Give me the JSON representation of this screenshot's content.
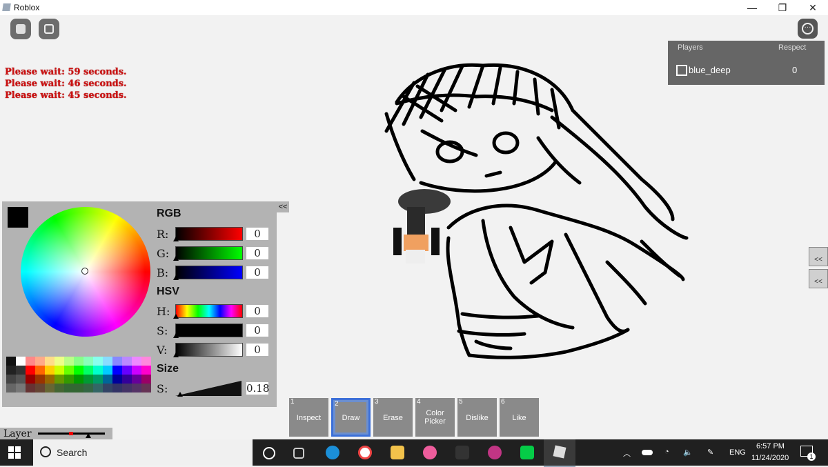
{
  "window": {
    "title": "Roblox",
    "minimize": "—",
    "restore": "❐",
    "close": "✕"
  },
  "waits": [
    "Please wait: 59 seconds.",
    "Please wait: 46 seconds.",
    "Please wait: 45 seconds."
  ],
  "players": {
    "header_players": "Players",
    "header_respect": "Respect",
    "rows": [
      {
        "name": "blue_deep",
        "respect": "0"
      }
    ]
  },
  "color_panel": {
    "collapse": "<<",
    "rgb_title": "RGB",
    "r_label": "R:",
    "r_value": "0",
    "g_label": "G:",
    "g_value": "0",
    "b_label": "B:",
    "b_value": "0",
    "hsv_title": "HSV",
    "h_label": "H:",
    "h_value": "0",
    "s_label": "S:",
    "s_value": "0",
    "v_label": "V:",
    "v_value": "0",
    "size_title": "Size",
    "size_label": "S:",
    "size_value": "0.18",
    "current_color": "#000000"
  },
  "tools": [
    {
      "num": "1",
      "label": "Inspect"
    },
    {
      "num": "2",
      "label": "Draw"
    },
    {
      "num": "3",
      "label": "Erase"
    },
    {
      "num": "4",
      "label": "Color Picker"
    },
    {
      "num": "5",
      "label": "Dislike"
    },
    {
      "num": "6",
      "label": "Like"
    }
  ],
  "layer": {
    "label": "Layer"
  },
  "side_icons": {
    "expand": "<<"
  },
  "taskbar": {
    "search": "Search",
    "language": "ENG",
    "time": "6:57 PM",
    "date": "11/24/2020",
    "notifications": "1"
  }
}
